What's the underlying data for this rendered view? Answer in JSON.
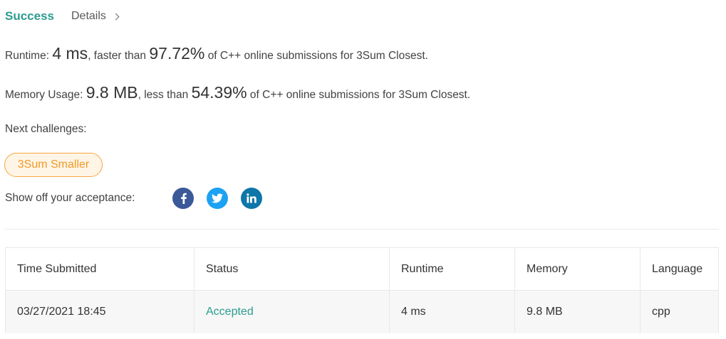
{
  "header": {
    "status": "Success",
    "details_label": "Details"
  },
  "runtime": {
    "label": "Runtime:",
    "value": "4 ms",
    "mid": ", faster than",
    "percent": "97.72%",
    "suffix": "of C++ online submissions for 3Sum Closest."
  },
  "memory": {
    "label": "Memory Usage:",
    "value": "9.8 MB",
    "mid": ", less than",
    "percent": "54.39%",
    "suffix": "of C++ online submissions for 3Sum Closest."
  },
  "next": {
    "label": "Next challenges:",
    "challenges": [
      "3Sum Smaller"
    ]
  },
  "share": {
    "label": "Show off your acceptance:",
    "icons": [
      "facebook-icon",
      "twitter-icon",
      "linkedin-icon"
    ]
  },
  "table": {
    "headers": [
      "Time Submitted",
      "Status",
      "Runtime",
      "Memory",
      "Language"
    ],
    "rows": [
      {
        "time": "03/27/2021 18:45",
        "status": "Accepted",
        "runtime": "4 ms",
        "memory": "9.8 MB",
        "language": "cpp"
      }
    ]
  },
  "colors": {
    "success": "#2a9c8f",
    "challenge": "#f09a27",
    "facebook": "#3b5998",
    "twitter": "#1da1f2",
    "linkedin": "#0e76a8"
  }
}
